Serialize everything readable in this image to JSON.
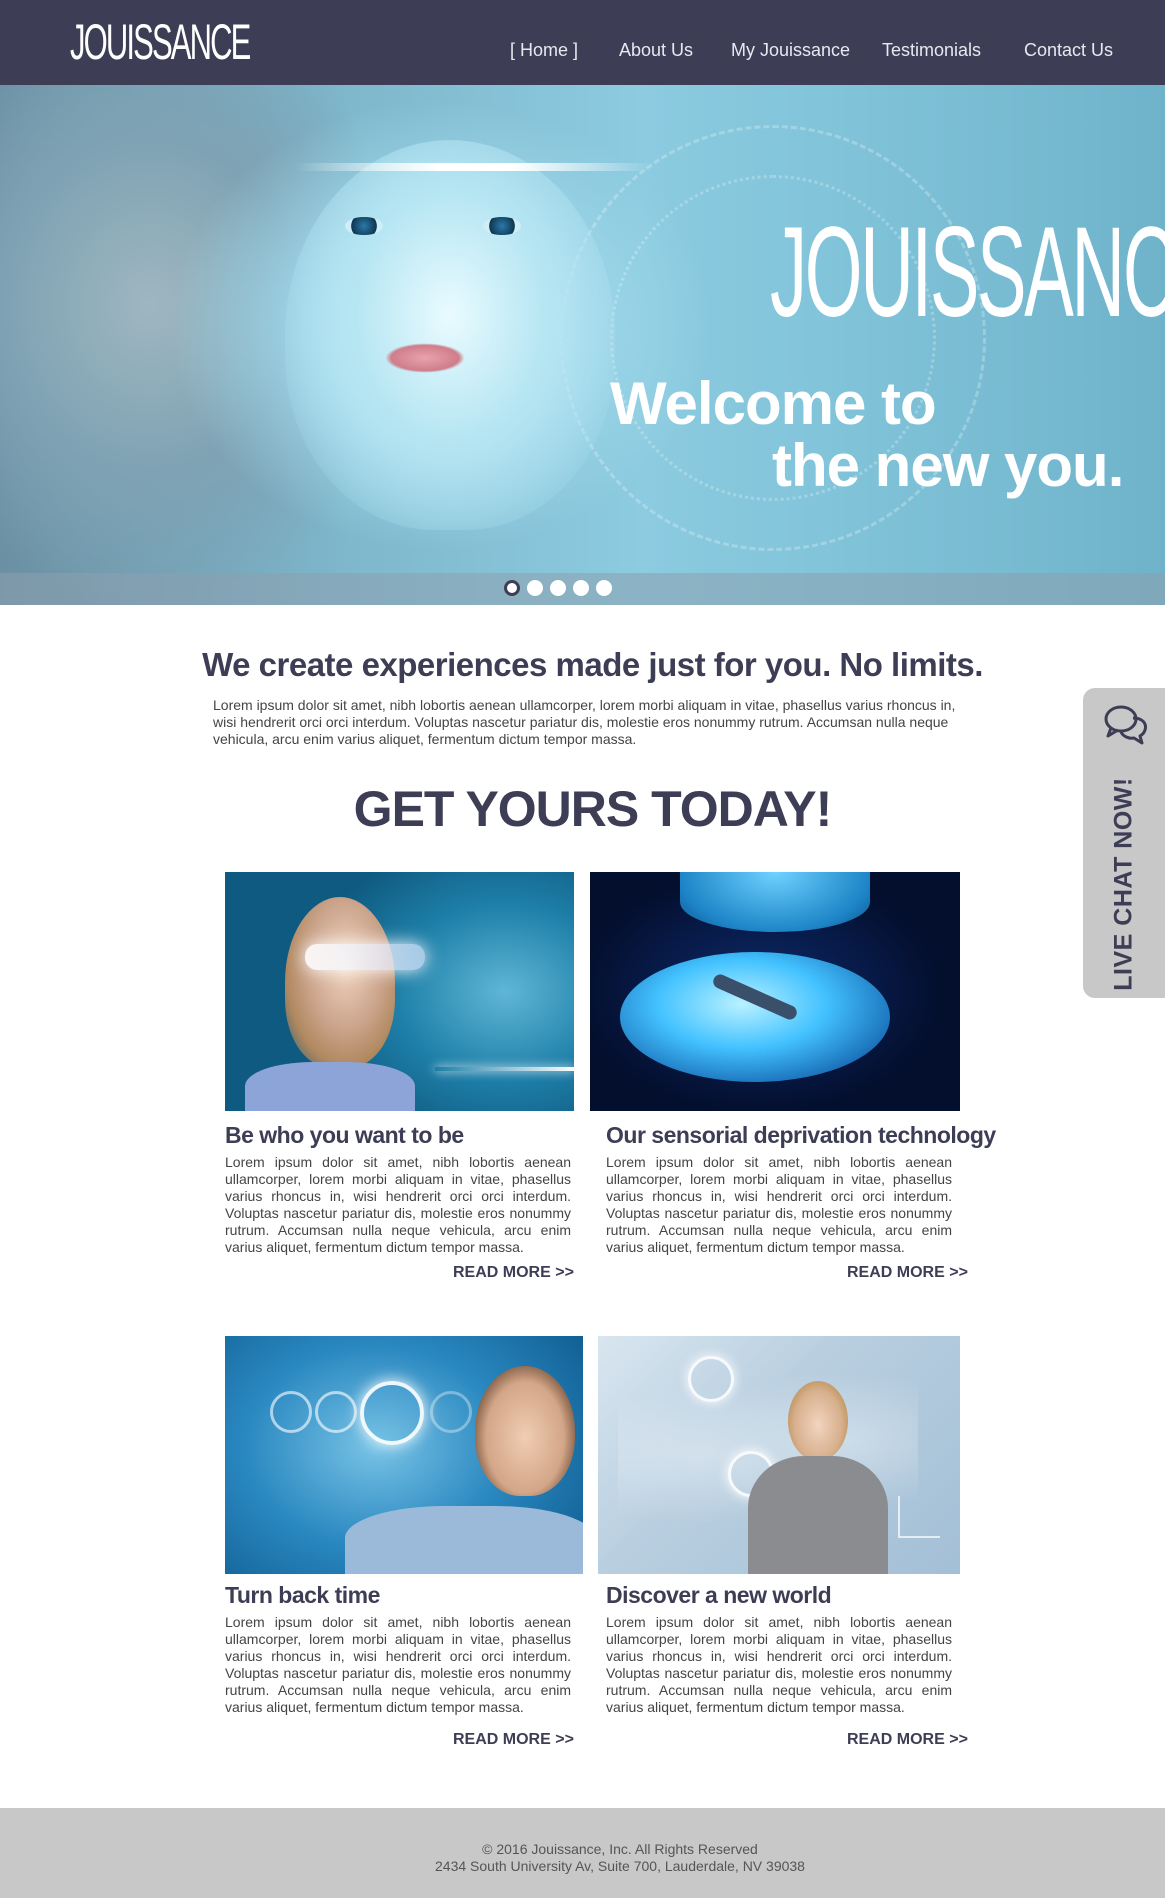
{
  "nav": {
    "logo": "JOUISSANCE",
    "items": [
      {
        "label": "[ Home ]"
      },
      {
        "label": "About Us"
      },
      {
        "label": "My Jouissance"
      },
      {
        "label": "Testimonials"
      },
      {
        "label": "Contact Us"
      }
    ],
    "background": "#3d3e55"
  },
  "hero": {
    "brand": "JOUISSANCE",
    "line1": "Welcome to",
    "line2": "the new you.",
    "slides_total": 5,
    "active_slide": 1
  },
  "intro": {
    "heading": "We create experiences made just for you. No limits.",
    "text": "Lorem ipsum dolor sit amet, nibh lobortis aenean ullamcorper, lorem morbi aliquam in vitae, phasellus varius rhoncus in, wisi hendrerit orci orci interdum. Voluptas nascetur pariatur dis, molestie eros nonummy rutrum. Accumsan nulla neque vehicula, arcu enim varius aliquet, fermentum dictum tempor massa."
  },
  "cta_heading": "GET YOURS TODAY!",
  "cards": [
    {
      "title": "Be who you want to be",
      "text": "Lorem ipsum dolor sit amet, nibh lobortis aenean ullamcorper, lorem morbi aliquam in vitae, phasellus varius rhoncus in, wisi hendrerit orci orci interdum. Voluptas nascetur pariatur dis, molestie eros nonummy rutrum. Accumsan nulla neque vehicula, arcu enim varius aliquet, fermentum dictum tempor massa.",
      "link": "READ MORE >>"
    },
    {
      "title": "Our sensorial deprivation technology",
      "text": "Lorem ipsum dolor sit amet, nibh lobortis aenean ullamcorper, lorem morbi aliquam in vitae, phasellus varius rhoncus in, wisi hendrerit orci orci interdum. Voluptas nascetur pariatur dis, molestie eros nonummy rutrum. Accumsan nulla neque vehicula, arcu enim varius aliquet, fermentum dictum tempor massa.",
      "link": "READ MORE >>"
    },
    {
      "title": "Turn back time",
      "text": "Lorem ipsum dolor sit amet, nibh lobortis aenean ullamcorper, lorem morbi aliquam in vitae, phasellus varius rhoncus in, wisi hendrerit orci orci interdum. Voluptas nascetur pariatur dis, molestie eros nonummy rutrum. Accumsan nulla neque vehicula, arcu enim varius aliquet, fermentum dictum tempor massa.",
      "link": "READ MORE >>"
    },
    {
      "title": "Discover a new world",
      "text": "Lorem ipsum dolor sit amet, nibh lobortis aenean ullamcorper, lorem morbi aliquam in vitae, phasellus varius rhoncus in, wisi hendrerit orci orci interdum. Voluptas nascetur pariatur dis, molestie eros nonummy rutrum. Accumsan nulla neque vehicula, arcu enim varius aliquet, fermentum dictum tempor massa.",
      "link": "READ MORE >>"
    }
  ],
  "live_chat": {
    "label": "LIVE CHAT NOW!",
    "icon": "chat-bubbles-icon"
  },
  "footer": {
    "copyright": "© 2016 Jouissance, Inc. All Rights Reserved",
    "address": "2434 South University Av, Suite 700, Lauderdale, NV 39038"
  },
  "colors": {
    "brand_dark": "#3d3e55",
    "footer_bg": "#c8c8c8",
    "hero_blue": "#8ccbe0"
  }
}
